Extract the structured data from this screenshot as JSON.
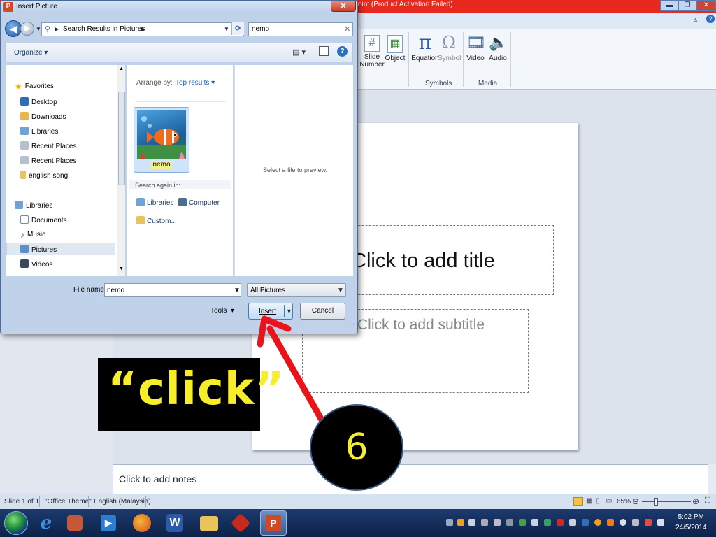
{
  "ppt": {
    "title_fragment": "oint (Product Activation Failed)",
    "ribbon": {
      "buttons": [
        {
          "label": "Slide\nNumber",
          "icon": "slide-number-icon"
        },
        {
          "label": "Object",
          "icon": "object-icon"
        },
        {
          "label": "Equation",
          "icon": "pi-icon"
        },
        {
          "label": "Symbol",
          "icon": "omega-icon"
        },
        {
          "label": "Video",
          "icon": "film-icon"
        },
        {
          "label": "Audio",
          "icon": "speaker-icon"
        }
      ],
      "groups": {
        "symbols": "Symbols",
        "media": "Media"
      }
    },
    "slide": {
      "title_placeholder": "Click to add title",
      "subtitle_placeholder": "Click to add subtitle"
    },
    "notes_placeholder": "Click to add notes",
    "status": {
      "slide": "Slide 1 of 1",
      "theme": "\"Office Theme\"",
      "language": "English (Malaysia)",
      "zoom": "65%"
    }
  },
  "dialog": {
    "title": "Insert Picture",
    "breadcrumb": "Search Results in Pictures",
    "search_value": "nemo",
    "organize": "Organize",
    "nav": {
      "favorites": "Favorites",
      "items": [
        "Desktop",
        "Downloads",
        "Libraries",
        "Recent Places",
        "Recent Places",
        "english song"
      ],
      "libraries": "Libraries",
      "lib_items": [
        "Documents",
        "Music",
        "Pictures",
        "Videos"
      ]
    },
    "arrange_label": "Arrange by:",
    "arrange_value": "Top results",
    "result_caption": "nemo",
    "search_again": "Search again in:",
    "search_again_links": [
      "Libraries",
      "Computer",
      "Custom..."
    ],
    "preview_text": "Select a file to preview.",
    "file_name_label": "File name:",
    "file_name_value": "nemo",
    "file_type": "All Pictures",
    "tools": "Tools",
    "insert": "Insert",
    "cancel": "Cancel"
  },
  "annotation": {
    "callout": "“click”",
    "step": "6",
    "colors": {
      "callout_text": "#f7ee2a",
      "arrow": "#e8131b"
    }
  },
  "taskbar": {
    "time": "5:02 PM",
    "date": "24/5/2014"
  }
}
